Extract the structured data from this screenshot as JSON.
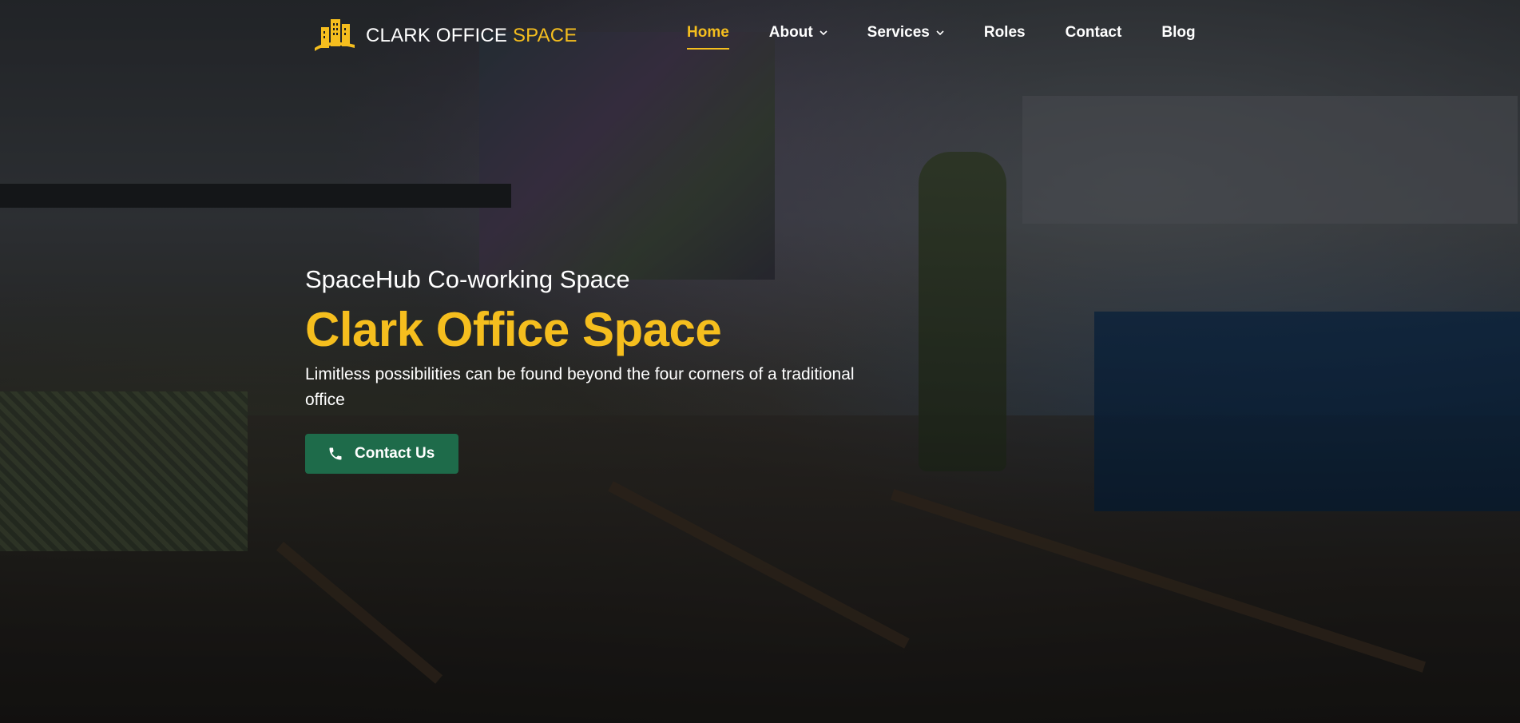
{
  "brand": {
    "name_main": "CLARK OFFICE ",
    "name_accent": "SPACE",
    "logo_icon": "buildings-icon",
    "accent_color": "#f5be1e"
  },
  "nav": {
    "items": [
      {
        "label": "Home",
        "active": true,
        "dropdown": false
      },
      {
        "label": "About",
        "active": false,
        "dropdown": true
      },
      {
        "label": "Services",
        "active": false,
        "dropdown": true
      },
      {
        "label": "Roles",
        "active": false,
        "dropdown": false
      },
      {
        "label": "Contact",
        "active": false,
        "dropdown": false
      },
      {
        "label": "Blog",
        "active": false,
        "dropdown": false
      }
    ]
  },
  "hero": {
    "subtitle": "SpaceHub Co-working Space",
    "title": "Clark Office Space",
    "description": "Limitless possibilities can be found beyond the four corners of a traditional office",
    "cta_label": "Contact Us",
    "cta_icon": "phone-icon",
    "cta_color": "#1e6b4a"
  }
}
